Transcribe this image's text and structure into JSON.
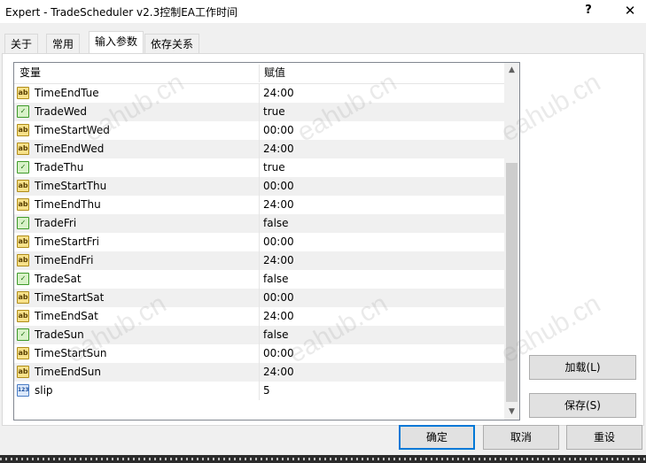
{
  "window": {
    "title": "Expert - TradeScheduler v2.3控制EA工作时间",
    "help_label": "?",
    "close_label": "✕"
  },
  "tabs": [
    {
      "label": "关于"
    },
    {
      "label": "常用"
    },
    {
      "label": "输入参数"
    },
    {
      "label": "依存关系"
    }
  ],
  "grid": {
    "columns": {
      "variable": "变量",
      "value": "赋值"
    },
    "rows": [
      {
        "icon": "ab",
        "name": "TimeEndTue",
        "value": "24:00"
      },
      {
        "icon": "bool",
        "name": "TradeWed",
        "value": "true"
      },
      {
        "icon": "ab",
        "name": "TimeStartWed",
        "value": "00:00"
      },
      {
        "icon": "ab",
        "name": "TimeEndWed",
        "value": "24:00"
      },
      {
        "icon": "bool",
        "name": "TradeThu",
        "value": "true"
      },
      {
        "icon": "ab",
        "name": "TimeStartThu",
        "value": "00:00"
      },
      {
        "icon": "ab",
        "name": "TimeEndThu",
        "value": "24:00"
      },
      {
        "icon": "bool",
        "name": "TradeFri",
        "value": "false"
      },
      {
        "icon": "ab",
        "name": "TimeStartFri",
        "value": "00:00"
      },
      {
        "icon": "ab",
        "name": "TimeEndFri",
        "value": "24:00"
      },
      {
        "icon": "bool",
        "name": "TradeSat",
        "value": "false"
      },
      {
        "icon": "ab",
        "name": "TimeStartSat",
        "value": "00:00"
      },
      {
        "icon": "ab",
        "name": "TimeEndSat",
        "value": "24:00"
      },
      {
        "icon": "bool",
        "name": "TradeSun",
        "value": "false"
      },
      {
        "icon": "ab",
        "name": "TimeStartSun",
        "value": "00:00"
      },
      {
        "icon": "ab",
        "name": "TimeEndSun",
        "value": "24:00"
      },
      {
        "icon": "num",
        "name": "slip",
        "value": "5"
      }
    ],
    "icon_glyphs": {
      "ab": "ab",
      "bool": "✓",
      "num": "123"
    },
    "scroll_up_icon": "▲",
    "scroll_down_icon": "▼"
  },
  "side_buttons": {
    "load_label": "加载(L)",
    "save_label": "保存(S)"
  },
  "footer_buttons": {
    "ok_label": "确定",
    "cancel_label": "取消",
    "reset_label": "重设"
  },
  "watermark_text": "eahub.cn",
  "colors": {
    "accent": "#0078d7",
    "row_alt": "#f0f0f0",
    "string_icon": "#f7e18a",
    "bool_icon": "#d8f2c8",
    "number_icon": "#dbe8fb"
  }
}
